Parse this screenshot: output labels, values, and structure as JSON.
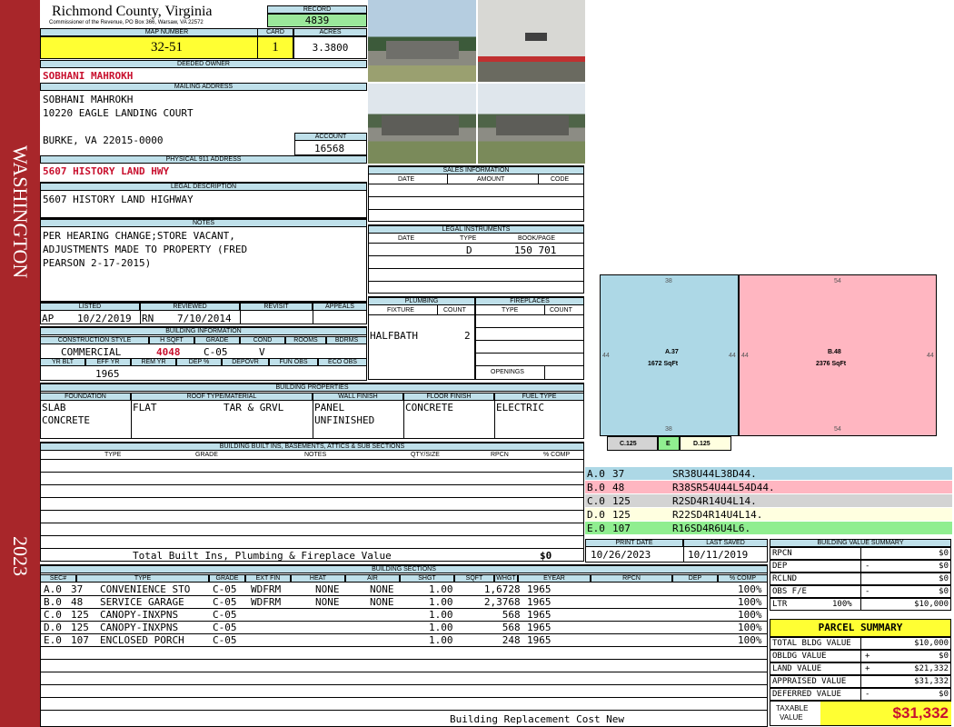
{
  "header": {
    "county": "Richmond County, Virginia",
    "commissioner": "Commissioner of the Revenue, PO Box 366, Warsaw, VA 22572",
    "record_label": "RECORD",
    "record": "4839",
    "map_label": "MAP NUMBER",
    "map": "32-51",
    "card_label": "CARD",
    "card": "1",
    "acres_label": "ACRES",
    "acres": "3.3800"
  },
  "side": {
    "district": "WASHINGTON",
    "year": "2023"
  },
  "owner": {
    "label": "DEEDED OWNER",
    "name": "SOBHANI MAHROKH",
    "mail_label": "MAILING ADDRESS",
    "mail1": "SOBHANI MAHROKH",
    "mail2": "10220 EAGLE LANDING COURT",
    "mail3": "BURKE, VA 22015-0000",
    "account_label": "ACCOUNT",
    "account": "16568",
    "addr_label": "PHYSICAL 911 ADDRESS",
    "addr": "5607 HISTORY LAND HWY"
  },
  "legal": {
    "label": "LEGAL DESCRIPTION",
    "text": "5607 HISTORY LAND HIGHWAY"
  },
  "notes": {
    "label": "NOTES",
    "l1": "PER HEARING CHANGE;STORE VACANT,",
    "l2": "ADJUSTMENTS MADE TO PROPERTY (FRED",
    "l3": "PEARSON 2-17-2015)"
  },
  "sales": {
    "label": "SALES INFORMATION",
    "h_date": "DATE",
    "h_amount": "AMOUNT",
    "h_code": "CODE"
  },
  "instruments": {
    "label": "LEGAL INSTRUMENTS",
    "h_date": "DATE",
    "h_type": "TYPE",
    "h_book": "BOOK/PAGE",
    "type": "D",
    "book": "150 701"
  },
  "review": {
    "h_listed": "LISTED",
    "h_reviewed": "REVIEWED",
    "h_revisit": "REVISIT",
    "h_appeals": "APPEALS",
    "listed_by": "AP",
    "listed": "10/2/2019",
    "reviewed_by": "RN",
    "reviewed": "7/10/2014"
  },
  "plumbing": {
    "label": "PLUMBING",
    "h_fixture": "FIXTURE",
    "h_count": "COUNT",
    "fixture": "HALFBATH",
    "count": "2"
  },
  "fireplaces": {
    "label": "FIREPLACES",
    "h_type": "TYPE",
    "h_count": "COUNT",
    "openings": "OPENINGS"
  },
  "bldg": {
    "label": "BUILDING INFORMATION",
    "h_style": "CONSTRUCTION STYLE",
    "h_hsqft": "H SQFT",
    "h_grade": "GRADE",
    "h_cond": "COND",
    "h_rooms": "ROOMS",
    "h_bdrms": "BDRMS",
    "style": "COMMERCIAL",
    "hsqft": "4048",
    "grade": "C-05",
    "cond": "V",
    "h_yrblt": "YR BLT",
    "h_effyr": "EFF YR",
    "h_remyr": "REM YR",
    "h_dep": "DEP %",
    "h_depovr": "DEPOVR",
    "h_fun": "FUN OBS",
    "h_eco": "ECO OBS",
    "effyr": "1965"
  },
  "props": {
    "label": "BUILDING PROPERTIES",
    "h_found": "FOUNDATION",
    "h_roof": "ROOF TYPE/MATERIAL",
    "h_wall": "WALL FINISH",
    "h_floor": "FLOOR FINISH",
    "h_fuel": "FUEL TYPE",
    "found1": "SLAB",
    "found2": "CONCRETE",
    "roof1": "FLAT",
    "roof2": "TAR & GRVL",
    "wall1": "PANEL",
    "wall2": "UNFINISHED",
    "floor": "CONCRETE",
    "fuel": "ELECTRIC"
  },
  "builtins": {
    "label": "BUILDING BUILT INS, BASEMENTS, ATTICS & SUB SECTIONS",
    "h_type": "TYPE",
    "h_grade": "GRADE",
    "h_notes": "NOTES",
    "h_qty": "QTY/SIZE",
    "h_rpcn": "RPCN",
    "h_comp": "% COMP",
    "total_label": "Total Built Ins, Plumbing & Fireplace Value",
    "total": "$0"
  },
  "sections": {
    "label": "BUILDING SECTIONS",
    "headers": [
      "SEC#",
      "TYPE",
      "GRADE",
      "EXT FIN",
      "HEAT",
      "AIR",
      "SHGT",
      "SQFT",
      "WHGT",
      "EYEAR",
      "RPCN",
      "DEP",
      "% COMP"
    ],
    "rows": [
      {
        "sec": "A.0",
        "code": "37",
        "type": "CONVENIENCE STO",
        "grade": "C-05",
        "ext": "WDFRM",
        "heat": "NONE",
        "air": "NONE",
        "shgt": "1.00",
        "sqft": "1,672",
        "whgt": "8",
        "eyear": "1965",
        "comp": "100%"
      },
      {
        "sec": "B.0",
        "code": "48",
        "type": "SERVICE GARAGE",
        "grade": "C-05",
        "ext": "WDFRM",
        "heat": "NONE",
        "air": "NONE",
        "shgt": "1.00",
        "sqft": "2,376",
        "whgt": "8",
        "eyear": "1965",
        "comp": "100%"
      },
      {
        "sec": "C.0",
        "code": "125",
        "type": "CANOPY-INXPNS",
        "grade": "C-05",
        "ext": "",
        "heat": "",
        "air": "",
        "shgt": "1.00",
        "sqft": "56",
        "whgt": "8",
        "eyear": "1965",
        "comp": "100%"
      },
      {
        "sec": "D.0",
        "code": "125",
        "type": "CANOPY-INXPNS",
        "grade": "C-05",
        "ext": "",
        "heat": "",
        "air": "",
        "shgt": "1.00",
        "sqft": "56",
        "whgt": "8",
        "eyear": "1965",
        "comp": "100%"
      },
      {
        "sec": "E.0",
        "code": "107",
        "type": "ENCLOSED PORCH",
        "grade": "C-05",
        "ext": "",
        "heat": "",
        "air": "",
        "shgt": "1.00",
        "sqft": "24",
        "whgt": "8",
        "eyear": "1965",
        "comp": "100%"
      }
    ],
    "footer": "Building Replacement Cost New"
  },
  "sketch": {
    "a_label": "A.37",
    "a_area": "1672 SqFt",
    "b_label": "B.48",
    "b_area": "2376 SqFt",
    "a_top": "38",
    "a_bottom": "38",
    "a_left": "44",
    "a_right": "44",
    "b_top": "54",
    "b_bottom": "54",
    "b_left": "44",
    "b_right": "44",
    "c": "C.125",
    "e": "E",
    "d": "D.125",
    "colors": {
      "a": "#add8e6",
      "b": "#ffb6c1",
      "c": "#d3d3d3",
      "d": "#ffffe0",
      "e": "#90ee90"
    }
  },
  "vectors": [
    {
      "sec": "A.0",
      "code": "37",
      "vec": "SR38U44L38D44."
    },
    {
      "sec": "B.0",
      "code": "48",
      "vec": "R38SR54U44L54D44."
    },
    {
      "sec": "C.0",
      "code": "125",
      "vec": "R2SD4R14U4L14."
    },
    {
      "sec": "D.0",
      "code": "125",
      "vec": "R22SD4R14U4L14."
    },
    {
      "sec": "E.0",
      "code": "107",
      "vec": "R16SD4R6U4L6."
    }
  ],
  "dates": {
    "h_print": "PRINT DATE",
    "h_saved": "LAST SAVED",
    "print": "10/26/2023",
    "saved": "10/11/2019"
  },
  "bvs": {
    "label": "BUILDING VALUE SUMMARY",
    "rpcn_l": "RPCN",
    "rpcn": "$0",
    "dep_l": "DEP",
    "dep_s": "-",
    "dep": "$0",
    "rclnd_l": "RCLND",
    "rclnd": "$0",
    "obs_l": "OBS F/E",
    "obs_s": "-",
    "obs": "$0",
    "ltr_l": "LTR",
    "ltr_p": "100%",
    "ltr": "$10,000"
  },
  "parcel": {
    "title": "PARCEL SUMMARY",
    "bldg_l": "TOTAL BLDG VALUE",
    "bldg": "$10,000",
    "obldg_l": "OBLDG VALUE",
    "obldg_s": "+",
    "obldg": "$0",
    "land_l": "LAND VALUE",
    "land_s": "+",
    "land": "$21,332",
    "appr_l": "APPRAISED VALUE",
    "appr": "$31,332",
    "def_l": "DEFERRED VALUE",
    "def_s": "-",
    "def": "$0",
    "tax_l1": "TAXABLE",
    "tax_l2": "VALUE",
    "tax": "$31,332"
  }
}
